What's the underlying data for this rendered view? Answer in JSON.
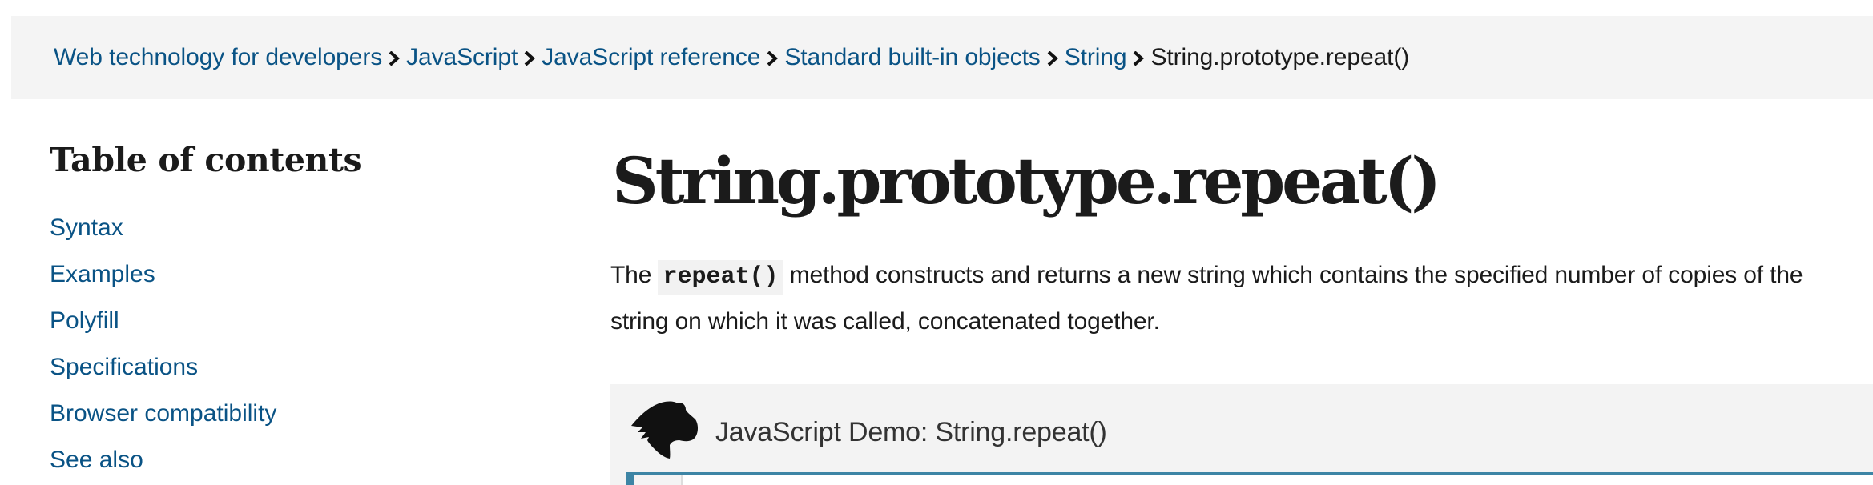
{
  "breadcrumb": {
    "items": [
      {
        "label": "Web technology for developers",
        "link": true
      },
      {
        "label": "JavaScript",
        "link": true
      },
      {
        "label": "JavaScript reference",
        "link": true
      },
      {
        "label": "Standard built-in objects",
        "link": true
      },
      {
        "label": "String",
        "link": true
      },
      {
        "label": "String.prototype.repeat()",
        "link": false
      }
    ],
    "separator_icon": "chevron-right-icon"
  },
  "toc": {
    "title": "Table of contents",
    "items": [
      {
        "label": "Syntax"
      },
      {
        "label": "Examples"
      },
      {
        "label": "Polyfill"
      },
      {
        "label": "Specifications"
      },
      {
        "label": "Browser compatibility"
      },
      {
        "label": "See also"
      }
    ]
  },
  "main": {
    "title": "String.prototype.repeat()",
    "intro": {
      "before": "The ",
      "code": "repeat()",
      "after": " method constructs and returns a new string which contains the specified number of copies of the string on which it was called, concatenated together."
    }
  },
  "demo": {
    "icon": "dino-icon",
    "title": "JavaScript Demo: String.repeat()"
  },
  "colors": {
    "link": "#0a5385",
    "text": "#1b1b1b",
    "breadcrumb_bg": "#f4f4f4",
    "demo_bg": "#f3f3f3",
    "editor_accent": "#3d85a5",
    "code_bg": "#f2f2f2"
  }
}
